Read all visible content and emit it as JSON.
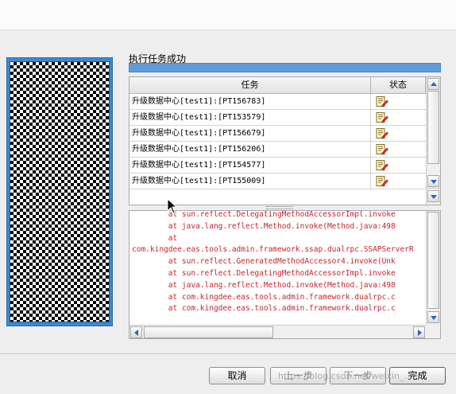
{
  "task_status_title": "执行任务成功",
  "tasks_table": {
    "columns": [
      "任务",
      "状态"
    ],
    "rows": [
      {
        "task": "升级数据中心[test1]:[PT156783]",
        "status_icon": "document-edit-icon"
      },
      {
        "task": "升级数据中心[test1]:[PT153579]",
        "status_icon": "document-edit-icon"
      },
      {
        "task": "升级数据中心[test1]:[PT156679]",
        "status_icon": "document-edit-icon"
      },
      {
        "task": "升级数据中心[test1]:[PT156206]",
        "status_icon": "document-edit-icon"
      },
      {
        "task": "升级数据中心[test1]:[PT154577]",
        "status_icon": "document-edit-icon"
      },
      {
        "task": "升级数据中心[test1]:[PT155009]",
        "status_icon": "document-edit-icon"
      }
    ]
  },
  "log": {
    "lines": [
      "        at sun.reflect.DelegatingMethodAccessorImpl.invoke",
      "        at java.lang.reflect.Method.invoke(Method.java:498",
      "        at",
      "com.kingdee.eas.tools.admin.framework.ssap.dualrpc.SSAPServerR",
      "        at sun.reflect.GeneratedMethodAccessor4.invoke(Unk",
      "        at sun.reflect.DelegatingMethodAccessorImpl.invoke",
      "        at java.lang.reflect.Method.invoke(Method.java:498",
      "        at com.kingdee.eas.tools.admin.framework.dualrpc.c",
      "        at com.kingdee.eas.tools.admin.framework.dualrpc.c"
    ],
    "text_color": "#c8242c"
  },
  "buttons": {
    "cancel": "取消",
    "prev": "上一步",
    "next": "下一步",
    "finish": "完成"
  },
  "watermark": "https://blog.csdn.net/weixin_...",
  "colors": {
    "progress_fill": "#5f9bd6",
    "side_frame": "#3d88cf",
    "scroll_arrow": "#2b63b6"
  }
}
